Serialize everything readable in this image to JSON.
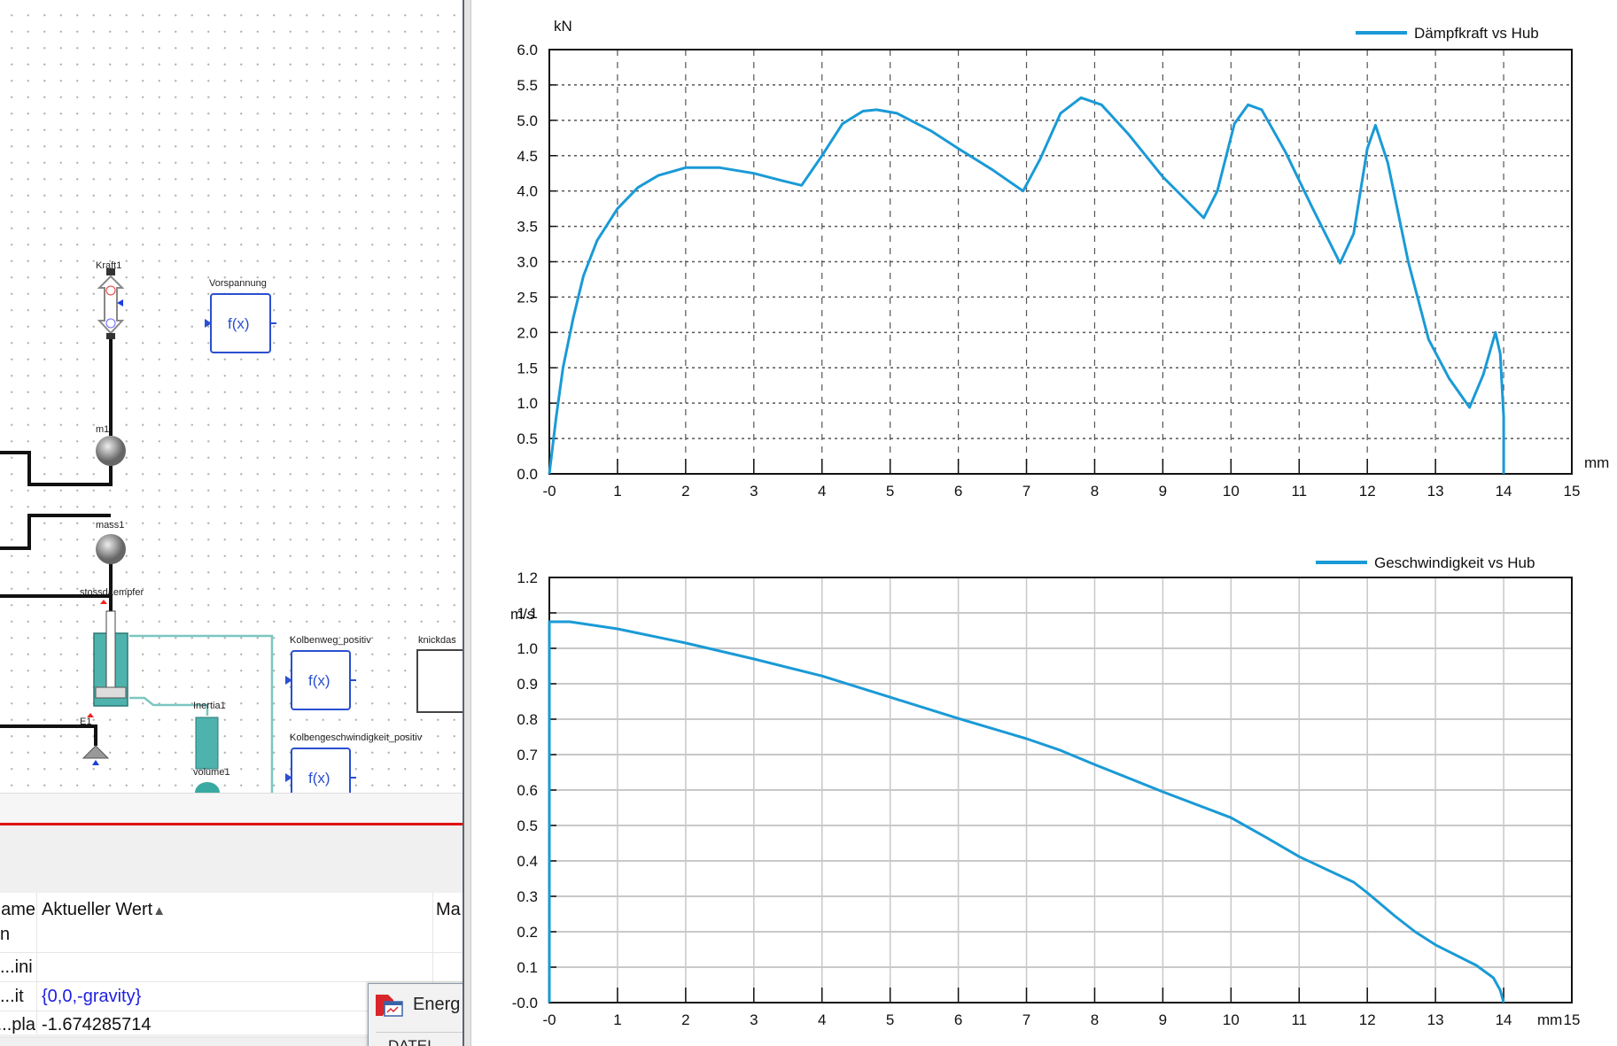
{
  "diagram": {
    "labels": {
      "kraft": "Kraft1",
      "vorspannung": "Vorspannung",
      "m1": "m1",
      "mass1": "mass1",
      "stossdaempfer": "stossdaempfer",
      "e1": "E1",
      "inertia": "Inertia1",
      "volume": "volume1",
      "kolbenweg": "Kolbenweg_positiv",
      "knick": "knickdas",
      "kolbengeschw": "Kolbengeschwindigkeit_positiv"
    },
    "fx": "f(x)"
  },
  "table": {
    "headers": {
      "name": "Name",
      "name2": "n",
      "value": "Aktueller Wert",
      "sort": "▲",
      "third": "Ma"
    },
    "rows": [
      {
        "name": "ini...",
        "value": ""
      },
      {
        "name": "it...",
        "value": "{0,0,-gravity}"
      },
      {
        "name": "pla...",
        "value": "-1.674285714"
      }
    ]
  },
  "popup": {
    "item": "Energ",
    "section": "DATEI"
  },
  "colors": {
    "series": "#1a9ad6",
    "link": "#2020e0",
    "red": "#e01010"
  },
  "chart_data": [
    {
      "type": "line",
      "title": "",
      "legend": "Dämpfkraft vs Hub",
      "legend_position": "top-right",
      "xlabel": "mm",
      "ylabel": "kN",
      "xlim": [
        0,
        15
      ],
      "ylim": [
        0,
        6
      ],
      "xticks": [
        "-0",
        "1",
        "2",
        "3",
        "4",
        "5",
        "6",
        "7",
        "8",
        "9",
        "10",
        "11",
        "12",
        "13",
        "14",
        "15"
      ],
      "yticks": [
        "0.0",
        "0.5",
        "1.0",
        "1.5",
        "2.0",
        "2.5",
        "3.0",
        "3.5",
        "4.0",
        "4.5",
        "5.0",
        "5.5",
        "6.0"
      ],
      "grid": "dashed",
      "x": [
        0,
        0.1,
        0.2,
        0.35,
        0.5,
        0.7,
        1,
        1.3,
        1.6,
        2,
        2.5,
        3,
        3.4,
        3.7,
        4,
        4.3,
        4.6,
        4.8,
        5.1,
        5.6,
        6,
        6.5,
        6.95,
        7.2,
        7.5,
        7.8,
        8.1,
        8.5,
        9,
        9.6,
        9.8,
        10.05,
        10.25,
        10.45,
        10.8,
        11.2,
        11.6,
        11.8,
        12.0,
        12.12,
        12.3,
        12.6,
        12.9,
        13.2,
        13.5,
        13.7,
        13.88,
        13.95,
        14.0,
        14.0
      ],
      "series": [
        {
          "name": "Dämpfkraft vs Hub",
          "values": [
            0,
            0.8,
            1.5,
            2.2,
            2.8,
            3.3,
            3.75,
            4.05,
            4.22,
            4.33,
            4.33,
            4.25,
            4.15,
            4.08,
            4.5,
            4.95,
            5.13,
            5.15,
            5.1,
            4.85,
            4.6,
            4.3,
            4.0,
            4.45,
            5.1,
            5.32,
            5.22,
            4.8,
            4.2,
            3.62,
            4.0,
            4.95,
            5.22,
            5.15,
            4.55,
            3.75,
            2.98,
            3.4,
            4.6,
            4.93,
            4.4,
            3.0,
            1.9,
            1.35,
            0.94,
            1.4,
            2.0,
            1.7,
            0.8,
            0
          ]
        }
      ]
    },
    {
      "type": "line",
      "title": "",
      "legend": "Geschwindigkeit vs Hub",
      "legend_position": "top-right",
      "xlabel": "mm",
      "ylabel": "m/s",
      "xlim": [
        0,
        15
      ],
      "ylim": [
        0,
        1.2
      ],
      "xticks": [
        "-0",
        "1",
        "2",
        "3",
        "4",
        "5",
        "6",
        "7",
        "8",
        "9",
        "10",
        "11",
        "12",
        "13",
        "14",
        "15"
      ],
      "yticks": [
        "-0.0",
        "0.1",
        "0.2",
        "0.3",
        "0.4",
        "0.5",
        "0.6",
        "0.7",
        "0.8",
        "0.9",
        "1.0",
        "1.1",
        "1.2"
      ],
      "grid": "solid",
      "x": [
        0,
        0,
        0.3,
        1,
        2,
        3,
        4,
        5,
        6,
        7,
        7.5,
        8,
        9,
        10,
        10.5,
        11,
        11.8,
        12,
        12.4,
        12.7,
        13,
        13.6,
        13.85,
        13.95,
        14
      ],
      "series": [
        {
          "name": "Geschwindigkeit vs Hub",
          "values": [
            0,
            1.075,
            1.075,
            1.055,
            1.015,
            0.97,
            0.922,
            0.862,
            0.802,
            0.745,
            0.712,
            0.672,
            0.595,
            0.522,
            0.468,
            0.412,
            0.34,
            0.31,
            0.245,
            0.2,
            0.163,
            0.105,
            0.07,
            0.035,
            0
          ]
        }
      ]
    }
  ]
}
